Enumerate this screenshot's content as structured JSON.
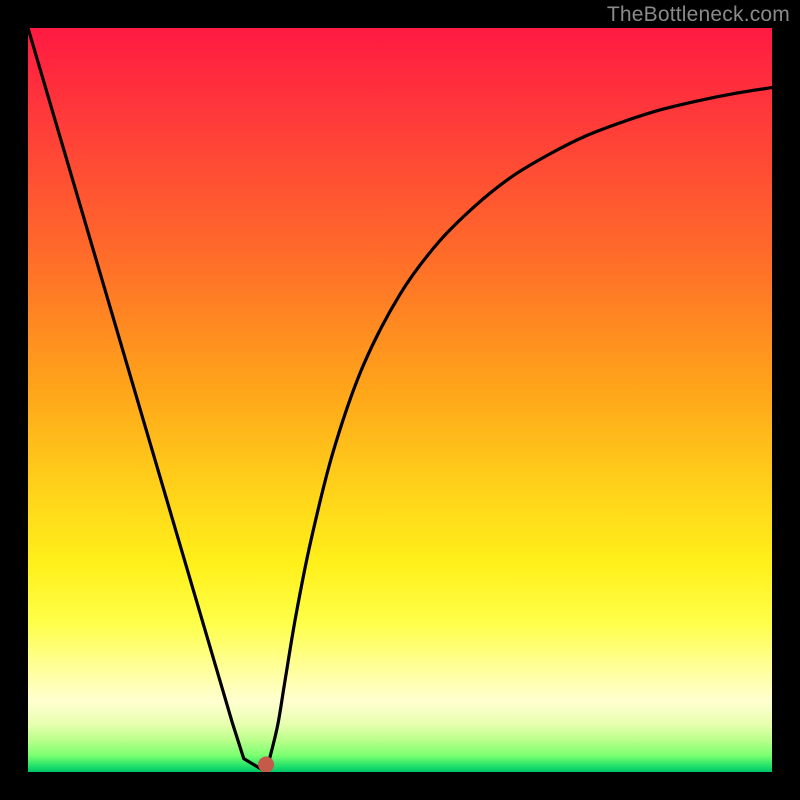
{
  "watermark": "TheBottleneck.com",
  "chart_data": {
    "type": "line",
    "title": "",
    "xlabel": "",
    "ylabel": "",
    "xlim": [
      0,
      1
    ],
    "ylim": [
      0,
      1
    ],
    "gradient_stops": [
      {
        "offset": 0.0,
        "color": "#ff1a42"
      },
      {
        "offset": 0.12,
        "color": "#ff3a3a"
      },
      {
        "offset": 0.3,
        "color": "#ff6a2a"
      },
      {
        "offset": 0.48,
        "color": "#ffa31a"
      },
      {
        "offset": 0.62,
        "color": "#ffd21a"
      },
      {
        "offset": 0.72,
        "color": "#fff01a"
      },
      {
        "offset": 0.8,
        "color": "#ffff4a"
      },
      {
        "offset": 0.86,
        "color": "#ffff9a"
      },
      {
        "offset": 0.905,
        "color": "#ffffd0"
      },
      {
        "offset": 0.935,
        "color": "#e8ffb0"
      },
      {
        "offset": 0.958,
        "color": "#b8ff8a"
      },
      {
        "offset": 0.978,
        "color": "#7aff70"
      },
      {
        "offset": 0.992,
        "color": "#22e26b"
      },
      {
        "offset": 1.0,
        "color": "#00c566"
      }
    ],
    "series": [
      {
        "name": "bottleneck-curve",
        "x": [
          0.0,
          0.05,
          0.1,
          0.15,
          0.2,
          0.25,
          0.275,
          0.29,
          0.3,
          0.31,
          0.32,
          0.335,
          0.345,
          0.36,
          0.38,
          0.41,
          0.45,
          0.5,
          0.55,
          0.6,
          0.65,
          0.7,
          0.75,
          0.8,
          0.85,
          0.9,
          0.95,
          1.0
        ],
        "y": [
          1.0,
          0.83,
          0.66,
          0.49,
          0.32,
          0.15,
          0.065,
          0.018,
          0.0,
          0.0,
          0.01,
          0.06,
          0.12,
          0.21,
          0.31,
          0.43,
          0.545,
          0.642,
          0.71,
          0.76,
          0.8,
          0.83,
          0.855,
          0.874,
          0.89,
          0.902,
          0.912,
          0.92
        ]
      }
    ],
    "marker": {
      "x": 0.32,
      "y": 0.01,
      "color": "#c45a4a",
      "radius": 8
    },
    "flat_min": {
      "x_start": 0.29,
      "x_end": 0.32,
      "y": 0.0
    }
  }
}
